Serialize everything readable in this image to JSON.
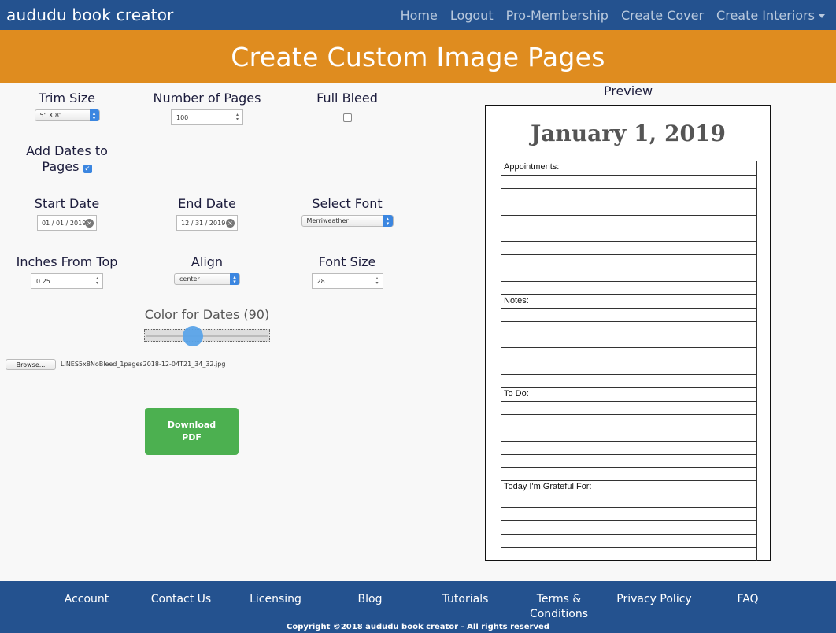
{
  "brand": "aududu book creator",
  "nav": {
    "home": "Home",
    "logout": "Logout",
    "pro": "Pro-Membership",
    "cover": "Create Cover",
    "interiors": "Create Interiors"
  },
  "banner_title": "Create Custom Image Pages",
  "form": {
    "trim_size_label": "Trim Size",
    "trim_size_value": "5\" X 8\"",
    "pages_label": "Number of Pages",
    "pages_value": "100",
    "bleed_label": "Full Bleed",
    "add_dates_label": "Add Dates to Pages",
    "start_label": "Start Date",
    "start_value": "01 / 01 / 2019",
    "end_label": "End Date",
    "end_value": "12 / 31 / 2019",
    "font_label": "Select Font",
    "font_value": "Merriweather",
    "inches_label": "Inches From Top",
    "inches_value": "0.25",
    "align_label": "Align",
    "align_value": "center",
    "font_size_label": "Font Size",
    "font_size_value": "28",
    "color_label": "Color for Dates (90)",
    "color_value": 90,
    "browse_label": "Browse...",
    "file_name": "LINES5x8NoBleed_1pages2018-12-04T21_34_32.jpg",
    "download_label": "Download PDF"
  },
  "preview": {
    "title": "Preview",
    "date": "January 1, 2019",
    "rows": [
      "Appointments:",
      "",
      "",
      "",
      "",
      "",
      "",
      "",
      "",
      "",
      "Notes:",
      "",
      "",
      "",
      "",
      "",
      "",
      "To Do:",
      "",
      "",
      "",
      "",
      "",
      "",
      "Today I'm Grateful For:",
      "",
      "",
      "",
      "",
      ""
    ]
  },
  "footer": {
    "links": [
      "Account",
      "Contact Us",
      "Licensing",
      "Blog",
      "Tutorials",
      "Terms & Conditions",
      "Privacy Policy",
      "FAQ"
    ],
    "copyright": "Copyright ©2018 aududu book creator - All rights reserved"
  },
  "colors": {
    "nav_bg": "#24528f",
    "banner_bg": "#df8c1f",
    "download_bg": "#4cb050",
    "slider_knob": "#5aa3e8"
  }
}
